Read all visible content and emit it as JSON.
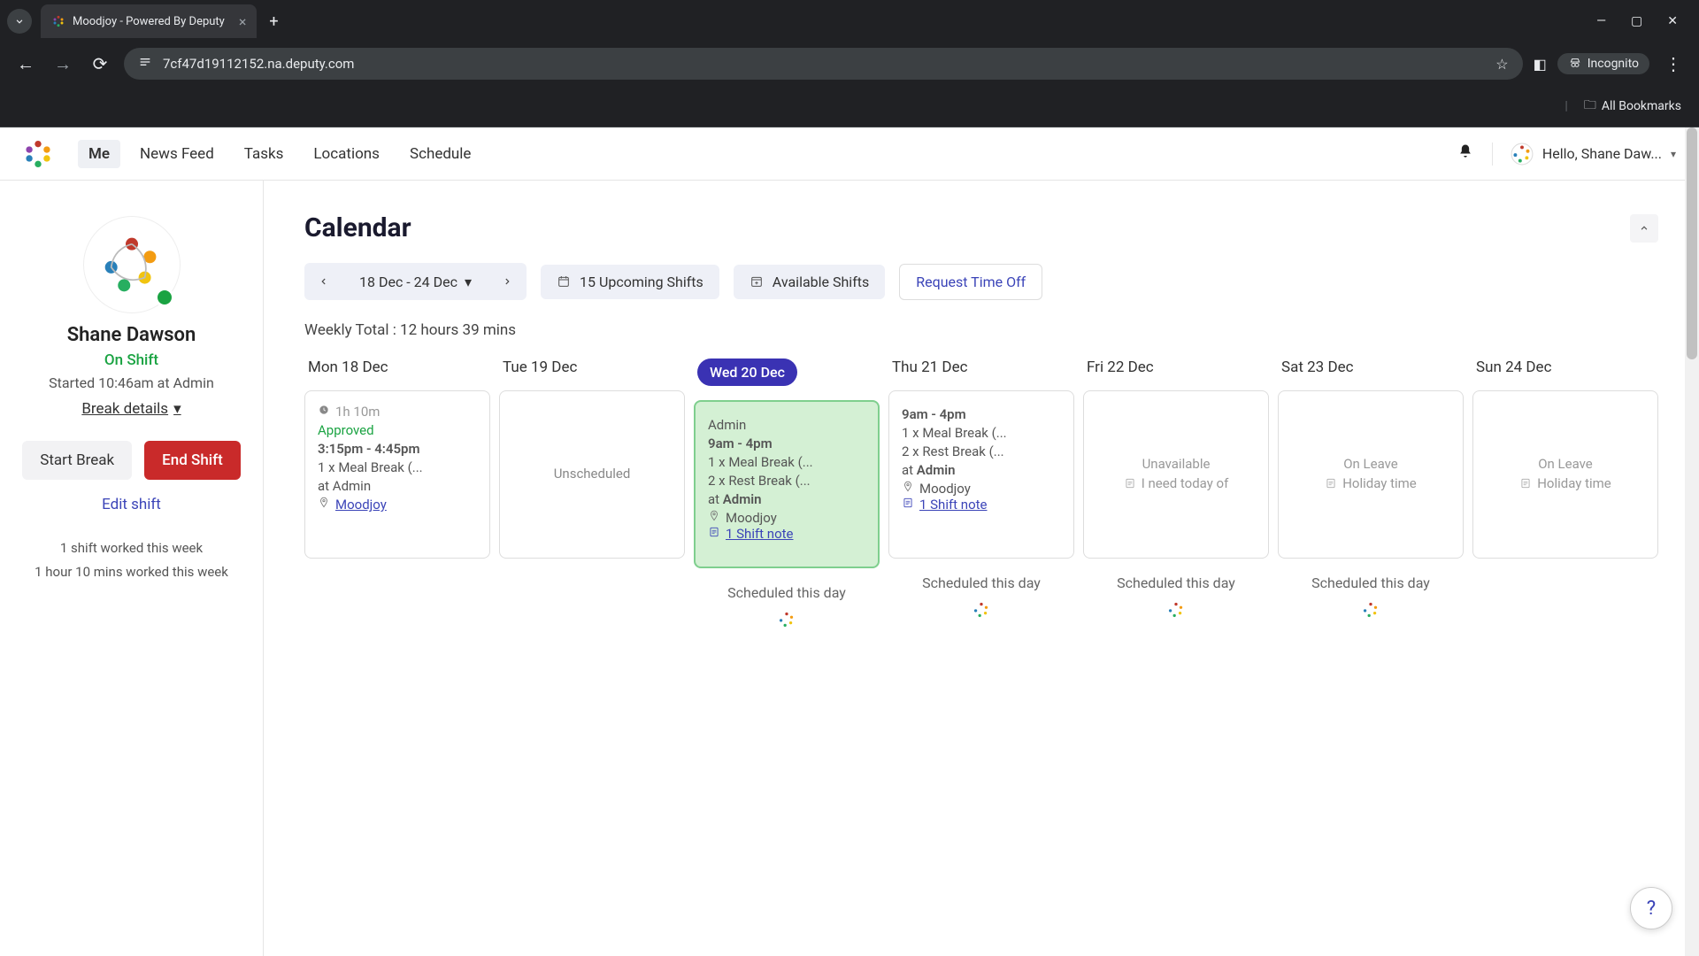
{
  "browser": {
    "tab_title": "Moodjoy - Powered By Deputy",
    "url": "7cf47d19112152.na.deputy.com",
    "incognito_label": "Incognito",
    "all_bookmarks": "All Bookmarks"
  },
  "nav": {
    "items": [
      "Me",
      "News Feed",
      "Tasks",
      "Locations",
      "Schedule"
    ],
    "active_index": 0,
    "greeting": "Hello, Shane Daw..."
  },
  "profile": {
    "name": "Shane Dawson",
    "status": "On Shift",
    "started": "Started 10:46am at Admin",
    "break_details": "Break details",
    "start_break": "Start Break",
    "end_shift": "End Shift",
    "edit_shift": "Edit shift",
    "stat1": "1 shift worked this week",
    "stat2": "1 hour 10 mins worked this week",
    "status_color": "#1aa342"
  },
  "calendar": {
    "title": "Calendar",
    "range": "18 Dec - 24 Dec",
    "upcoming": "15 Upcoming Shifts",
    "available": "Available Shifts",
    "request": "Request Time Off",
    "weekly_total": "Weekly Total : 12 hours 39 mins",
    "scheduled_label": "Scheduled this day"
  },
  "days": [
    {
      "label": "Mon 18 Dec",
      "is_today": false,
      "type": "shift",
      "duration": "1h 10m",
      "status": "Approved",
      "status_color": "#1aa342",
      "time": "3:15pm - 4:45pm",
      "meal": "1 x Meal Break (...",
      "rest": "",
      "at": "at Admin",
      "loc": "Moodjoy",
      "note": "",
      "show_scheduled": false
    },
    {
      "label": "Tue 19 Dec",
      "is_today": false,
      "type": "unscheduled",
      "empty_text": "Unscheduled",
      "show_scheduled": false
    },
    {
      "label": "Wed 20 Dec",
      "is_today": true,
      "type": "shift",
      "title": "Admin",
      "time": "9am - 4pm",
      "meal": "1 x Meal Break (...",
      "rest": "2 x Rest Break (...",
      "at_prefix": "at ",
      "at_bold": "Admin",
      "loc": "Moodjoy",
      "note": "1 Shift note",
      "show_scheduled": true
    },
    {
      "label": "Thu 21 Dec",
      "is_today": false,
      "type": "shift",
      "time": "9am - 4pm",
      "meal": "1 x Meal Break (...",
      "rest": "2 x Rest Break (...",
      "at_prefix": "at ",
      "at_bold": "Admin",
      "loc": "Moodjoy",
      "note": "1 Shift note",
      "show_scheduled": true
    },
    {
      "label": "Fri 22 Dec",
      "is_today": false,
      "type": "unavailable",
      "empty_text": "Unavailable",
      "sub": "I need today of",
      "show_scheduled": true
    },
    {
      "label": "Sat 23 Dec",
      "is_today": false,
      "type": "leave",
      "empty_text": "On Leave",
      "sub": "Holiday time",
      "show_scheduled": true
    },
    {
      "label": "Sun 24 Dec",
      "is_today": false,
      "type": "leave",
      "empty_text": "On Leave",
      "sub": "Holiday time",
      "show_scheduled": false
    }
  ],
  "colors": {
    "accent": "#3a32b3",
    "today_bg": "#d4f0d4",
    "today_border": "#7fcf8e",
    "danger": "#c92a2a",
    "link": "#3b44b8"
  }
}
